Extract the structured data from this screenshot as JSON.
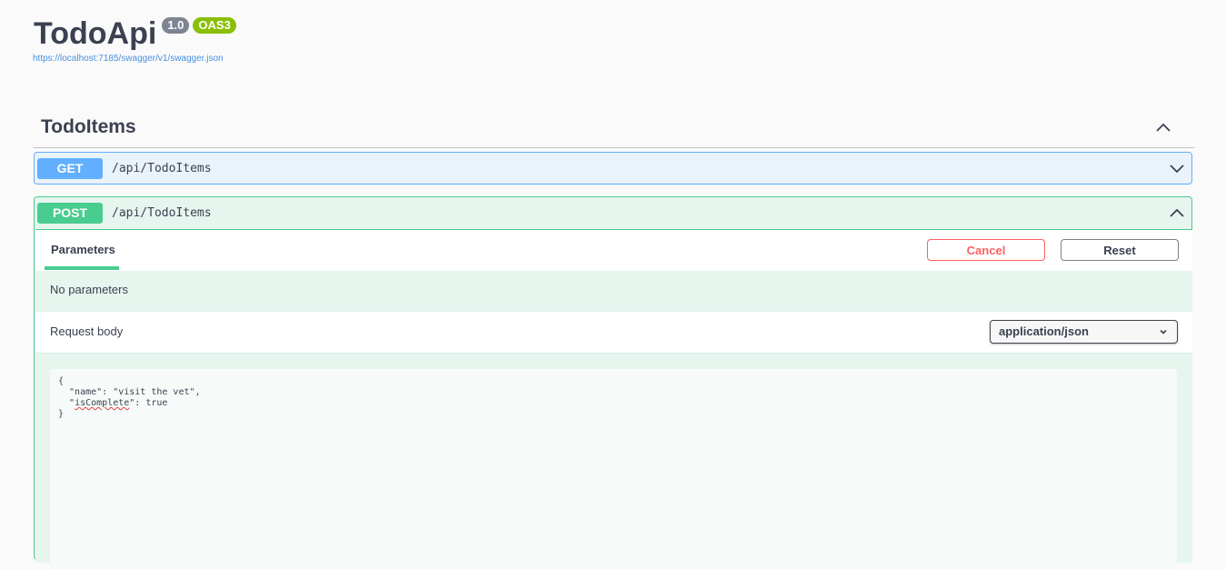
{
  "info": {
    "title": "TodoApi",
    "version": "1.0",
    "oas_badge": "OAS3",
    "spec_url": "https://localhost:7185/swagger/v1/swagger.json"
  },
  "tag": {
    "name": "TodoItems",
    "expanded": true
  },
  "operations": [
    {
      "method": "GET",
      "path": "/api/TodoItems",
      "expanded": false,
      "color": "#61affe"
    },
    {
      "method": "POST",
      "path": "/api/TodoItems",
      "expanded": true,
      "color": "#49cc90"
    }
  ],
  "post_panel": {
    "parameters_tab": "Parameters",
    "cancel_label": "Cancel",
    "reset_label": "Reset",
    "no_parameters": "No parameters",
    "request_body_label": "Request body",
    "content_type": "application/json",
    "body_lines": {
      "open": "{",
      "line1": "  \"name\": \"visit the vet\",",
      "line2_key": "isComplete",
      "line2_rest": "\": true",
      "close": "}"
    }
  },
  "colors": {
    "get": "#61affe",
    "post": "#49cc90",
    "cancel": "#ff6060",
    "link": "#4990e2",
    "version_badge": "#7d8492",
    "oas_badge": "#89bf04"
  }
}
